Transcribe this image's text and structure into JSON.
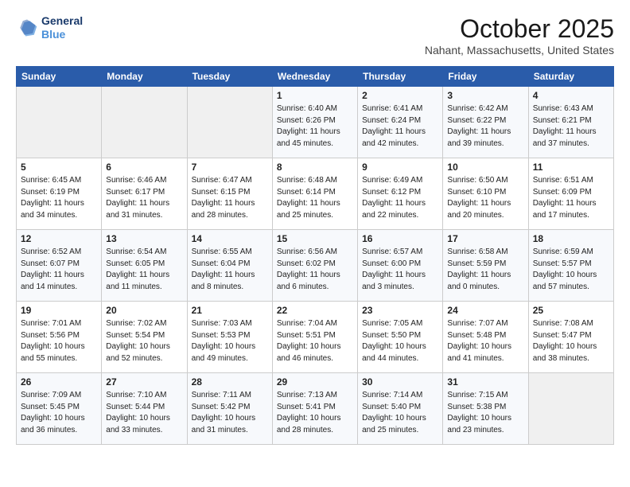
{
  "logo": {
    "line1": "General",
    "line2": "Blue"
  },
  "title": "October 2025",
  "location": "Nahant, Massachusetts, United States",
  "days_of_week": [
    "Sunday",
    "Monday",
    "Tuesday",
    "Wednesday",
    "Thursday",
    "Friday",
    "Saturday"
  ],
  "weeks": [
    [
      {
        "day": "",
        "info": ""
      },
      {
        "day": "",
        "info": ""
      },
      {
        "day": "",
        "info": ""
      },
      {
        "day": "1",
        "info": "Sunrise: 6:40 AM\nSunset: 6:26 PM\nDaylight: 11 hours\nand 45 minutes."
      },
      {
        "day": "2",
        "info": "Sunrise: 6:41 AM\nSunset: 6:24 PM\nDaylight: 11 hours\nand 42 minutes."
      },
      {
        "day": "3",
        "info": "Sunrise: 6:42 AM\nSunset: 6:22 PM\nDaylight: 11 hours\nand 39 minutes."
      },
      {
        "day": "4",
        "info": "Sunrise: 6:43 AM\nSunset: 6:21 PM\nDaylight: 11 hours\nand 37 minutes."
      }
    ],
    [
      {
        "day": "5",
        "info": "Sunrise: 6:45 AM\nSunset: 6:19 PM\nDaylight: 11 hours\nand 34 minutes."
      },
      {
        "day": "6",
        "info": "Sunrise: 6:46 AM\nSunset: 6:17 PM\nDaylight: 11 hours\nand 31 minutes."
      },
      {
        "day": "7",
        "info": "Sunrise: 6:47 AM\nSunset: 6:15 PM\nDaylight: 11 hours\nand 28 minutes."
      },
      {
        "day": "8",
        "info": "Sunrise: 6:48 AM\nSunset: 6:14 PM\nDaylight: 11 hours\nand 25 minutes."
      },
      {
        "day": "9",
        "info": "Sunrise: 6:49 AM\nSunset: 6:12 PM\nDaylight: 11 hours\nand 22 minutes."
      },
      {
        "day": "10",
        "info": "Sunrise: 6:50 AM\nSunset: 6:10 PM\nDaylight: 11 hours\nand 20 minutes."
      },
      {
        "day": "11",
        "info": "Sunrise: 6:51 AM\nSunset: 6:09 PM\nDaylight: 11 hours\nand 17 minutes."
      }
    ],
    [
      {
        "day": "12",
        "info": "Sunrise: 6:52 AM\nSunset: 6:07 PM\nDaylight: 11 hours\nand 14 minutes."
      },
      {
        "day": "13",
        "info": "Sunrise: 6:54 AM\nSunset: 6:05 PM\nDaylight: 11 hours\nand 11 minutes."
      },
      {
        "day": "14",
        "info": "Sunrise: 6:55 AM\nSunset: 6:04 PM\nDaylight: 11 hours\nand 8 minutes."
      },
      {
        "day": "15",
        "info": "Sunrise: 6:56 AM\nSunset: 6:02 PM\nDaylight: 11 hours\nand 6 minutes."
      },
      {
        "day": "16",
        "info": "Sunrise: 6:57 AM\nSunset: 6:00 PM\nDaylight: 11 hours\nand 3 minutes."
      },
      {
        "day": "17",
        "info": "Sunrise: 6:58 AM\nSunset: 5:59 PM\nDaylight: 11 hours\nand 0 minutes."
      },
      {
        "day": "18",
        "info": "Sunrise: 6:59 AM\nSunset: 5:57 PM\nDaylight: 10 hours\nand 57 minutes."
      }
    ],
    [
      {
        "day": "19",
        "info": "Sunrise: 7:01 AM\nSunset: 5:56 PM\nDaylight: 10 hours\nand 55 minutes."
      },
      {
        "day": "20",
        "info": "Sunrise: 7:02 AM\nSunset: 5:54 PM\nDaylight: 10 hours\nand 52 minutes."
      },
      {
        "day": "21",
        "info": "Sunrise: 7:03 AM\nSunset: 5:53 PM\nDaylight: 10 hours\nand 49 minutes."
      },
      {
        "day": "22",
        "info": "Sunrise: 7:04 AM\nSunset: 5:51 PM\nDaylight: 10 hours\nand 46 minutes."
      },
      {
        "day": "23",
        "info": "Sunrise: 7:05 AM\nSunset: 5:50 PM\nDaylight: 10 hours\nand 44 minutes."
      },
      {
        "day": "24",
        "info": "Sunrise: 7:07 AM\nSunset: 5:48 PM\nDaylight: 10 hours\nand 41 minutes."
      },
      {
        "day": "25",
        "info": "Sunrise: 7:08 AM\nSunset: 5:47 PM\nDaylight: 10 hours\nand 38 minutes."
      }
    ],
    [
      {
        "day": "26",
        "info": "Sunrise: 7:09 AM\nSunset: 5:45 PM\nDaylight: 10 hours\nand 36 minutes."
      },
      {
        "day": "27",
        "info": "Sunrise: 7:10 AM\nSunset: 5:44 PM\nDaylight: 10 hours\nand 33 minutes."
      },
      {
        "day": "28",
        "info": "Sunrise: 7:11 AM\nSunset: 5:42 PM\nDaylight: 10 hours\nand 31 minutes."
      },
      {
        "day": "29",
        "info": "Sunrise: 7:13 AM\nSunset: 5:41 PM\nDaylight: 10 hours\nand 28 minutes."
      },
      {
        "day": "30",
        "info": "Sunrise: 7:14 AM\nSunset: 5:40 PM\nDaylight: 10 hours\nand 25 minutes."
      },
      {
        "day": "31",
        "info": "Sunrise: 7:15 AM\nSunset: 5:38 PM\nDaylight: 10 hours\nand 23 minutes."
      },
      {
        "day": "",
        "info": ""
      }
    ]
  ]
}
